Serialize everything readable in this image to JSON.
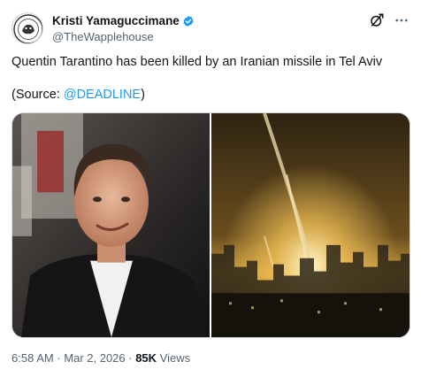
{
  "author": {
    "display_name": "Kristi Yamaguccimane",
    "handle": "@TheWapplehouse",
    "verified": true,
    "avatar_icon": "avatar-emblem-icon"
  },
  "header_actions": {
    "grok_icon": "grok-icon",
    "more_icon": "more-icon"
  },
  "tweet": {
    "text_line1": "Quentin Tarantino has been killed by an Iranian missile in Tel Aviv",
    "source_prefix": "(Source: ",
    "source_mention": "@DEADLINE",
    "source_suffix": ")"
  },
  "media": [
    {
      "kind": "photo",
      "subject": "man in black jacket at event"
    },
    {
      "kind": "photo",
      "subject": "night city explosion glow"
    }
  ],
  "footer": {
    "time": "6:58 AM",
    "separator": " · ",
    "date": "Mar 2, 2026",
    "views_count": "85K",
    "views_label": " Views"
  },
  "colors": {
    "accent": "#1d9bf0",
    "text": "#0f1419",
    "muted": "#536471",
    "border": "#cfd9de"
  }
}
